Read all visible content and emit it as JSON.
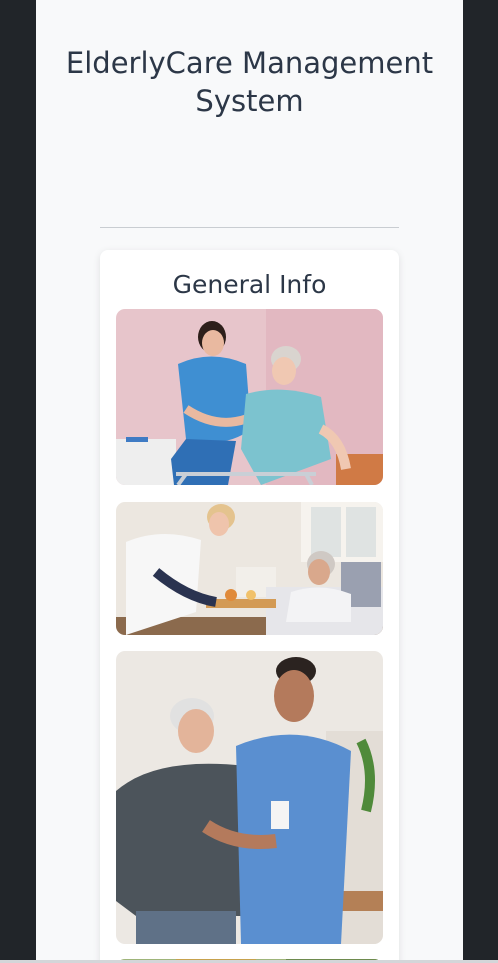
{
  "header": {
    "title": "ElderlyCare Management System"
  },
  "info_card": {
    "title": "General Info",
    "images": [
      {
        "name": "caregiver-assisting-walker"
      },
      {
        "name": "nurse-serving-meal"
      },
      {
        "name": "nurse-with-elderly-man"
      }
    ]
  },
  "colors": {
    "sidebar": "#212529",
    "content_bg": "#f8f9fa",
    "heading": "#2c3747"
  }
}
